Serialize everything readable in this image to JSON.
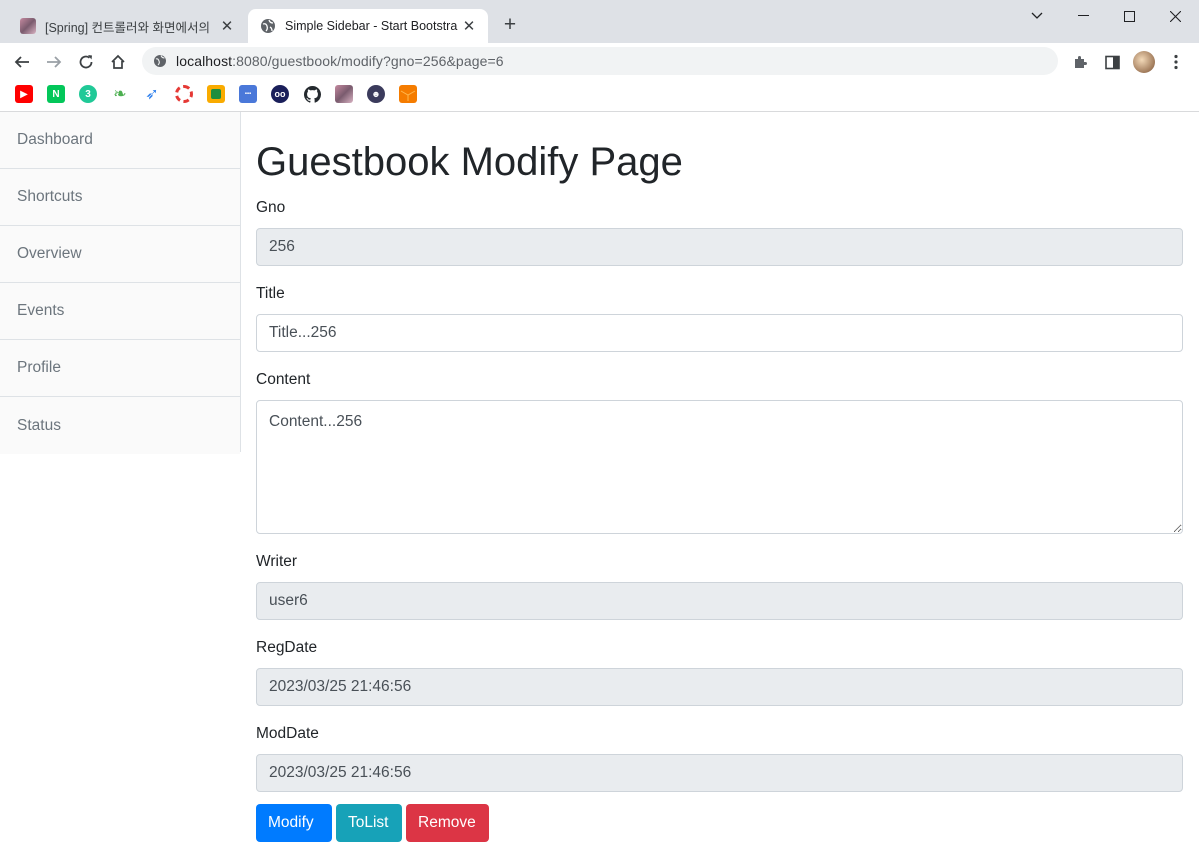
{
  "browser": {
    "tabs": [
      {
        "title": "[Spring] 컨트롤러와 화면에서의 ",
        "active": false
      },
      {
        "title": "Simple Sidebar - Start Bootstrap",
        "active": true
      }
    ],
    "new_tab_label": "+",
    "url": {
      "host": "localhost",
      "rest": ":8080/guestbook/modify?gno=256&page=6"
    },
    "bookmarks": [
      "youtube-icon",
      "naver-icon",
      "bookmark-icon",
      "leaf-icon",
      "feather-icon",
      "lifebuoy-icon",
      "classroom-icon",
      "code-icon",
      "owl-icon",
      "github-icon",
      "image-icon",
      "dev-icon",
      "box-icon"
    ]
  },
  "sidebar": {
    "items": [
      {
        "label": "Dashboard"
      },
      {
        "label": "Shortcuts"
      },
      {
        "label": "Overview"
      },
      {
        "label": "Events"
      },
      {
        "label": "Profile"
      },
      {
        "label": "Status"
      }
    ]
  },
  "page": {
    "title": "Guestbook Modify Page",
    "fields": {
      "gno": {
        "label": "Gno",
        "value": "256"
      },
      "title": {
        "label": "Title",
        "value": "Title...256"
      },
      "content": {
        "label": "Content",
        "value": "Content...256"
      },
      "writer": {
        "label": "Writer",
        "value": "user6"
      },
      "regdate": {
        "label": "RegDate",
        "value": "2023/03/25 21:46:56"
      },
      "moddate": {
        "label": "ModDate",
        "value": "2023/03/25 21:46:56"
      }
    },
    "buttons": {
      "modify": "Modify",
      "tolist": "ToList",
      "remove": "Remove"
    }
  },
  "colors": {
    "primary": "#007bff",
    "info": "#17a2b8",
    "danger": "#dc3545"
  }
}
